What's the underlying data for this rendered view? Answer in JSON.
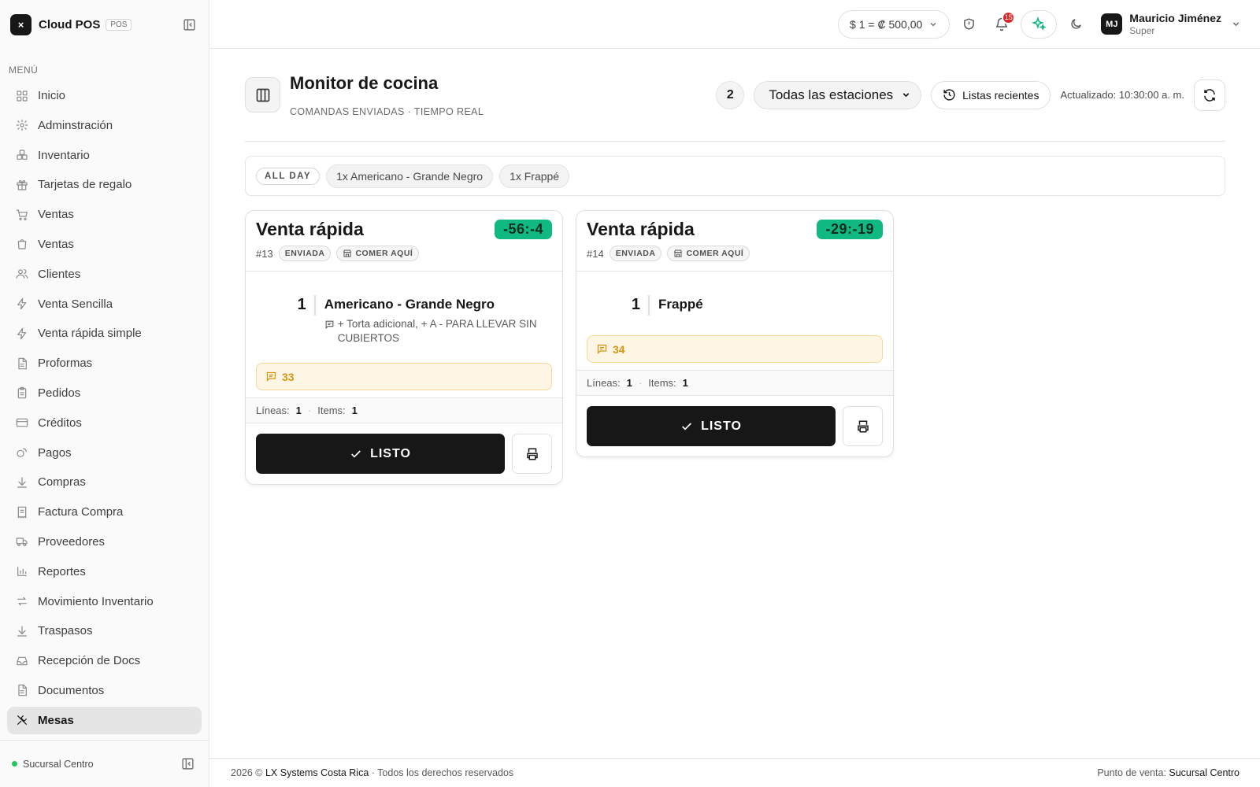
{
  "app": {
    "logo": "×",
    "name": "Cloud POS",
    "badge": "POS"
  },
  "sidebar": {
    "menu_title": "MENÚ",
    "items": [
      {
        "label": "Inicio",
        "icon": "grid-icon"
      },
      {
        "label": "Adminstración",
        "icon": "gear-icon"
      },
      {
        "label": "Inventario",
        "icon": "boxes-icon"
      },
      {
        "label": "Tarjetas de regalo",
        "icon": "gift-icon"
      },
      {
        "label": "Ventas",
        "icon": "cart-icon"
      },
      {
        "label": "Ventas",
        "icon": "shopping-bag-icon"
      },
      {
        "label": "Clientes",
        "icon": "users-icon"
      },
      {
        "label": "Venta Sencilla",
        "icon": "bolt-icon"
      },
      {
        "label": "Venta rápida simple",
        "icon": "bolt-icon"
      },
      {
        "label": "Proformas",
        "icon": "document-icon"
      },
      {
        "label": "Pedidos",
        "icon": "clipboard-icon"
      },
      {
        "label": "Créditos",
        "icon": "credit-card-icon"
      },
      {
        "label": "Pagos",
        "icon": "coins-icon"
      },
      {
        "label": "Compras",
        "icon": "download-icon"
      },
      {
        "label": "Factura Compra",
        "icon": "receipt-icon"
      },
      {
        "label": "Proveedores",
        "icon": "truck-icon"
      },
      {
        "label": "Reportes",
        "icon": "bar-chart-icon"
      },
      {
        "label": "Movimiento Inventario",
        "icon": "arrows-swap-icon"
      },
      {
        "label": "Traspasos",
        "icon": "download-icon"
      },
      {
        "label": "Recepción de Docs",
        "icon": "inbox-icon"
      },
      {
        "label": "Documentos",
        "icon": "document-icon"
      },
      {
        "label": "Mesas",
        "icon": "utensils-icon",
        "active": true
      }
    ],
    "branch": "Sucursal Centro"
  },
  "topbar": {
    "exchange_rate": "$ 1 =  ₡ 500,00",
    "notifications_count": "15",
    "user": {
      "initials": "MJ",
      "name": "Mauricio Jiménez",
      "role": "Super"
    }
  },
  "page": {
    "title": "Monitor de cocina",
    "subtitle": "COMANDAS ENVIADAS · TIEMPO REAL",
    "order_count": "2",
    "station": "Todas las estaciones",
    "recent_button": "Listas recientes",
    "updated": "Actualizado: 10:30:00 a. m."
  },
  "all_day": {
    "tag": "ALL DAY",
    "items": [
      "1x Americano - Grande Negro",
      "1x Frappé"
    ]
  },
  "orders": [
    {
      "title": "Venta rápida",
      "timer": "-56:-4",
      "number": "#13",
      "status": "ENVIADA",
      "service": "COMER AQUÍ",
      "lines": [
        {
          "qty": "1",
          "name": "Americano - Grande Negro",
          "mods": "+ Torta adicional, + A - PARA LLEVAR SIN CUBIERTOS"
        }
      ],
      "note": "33",
      "stats": {
        "lines_label": "Líneas:",
        "lines": "1",
        "items_label": "Items:",
        "items": "1"
      },
      "ready_label": "LISTO"
    },
    {
      "title": "Venta rápida",
      "timer": "-29:-19",
      "number": "#14",
      "status": "ENVIADA",
      "service": "COMER AQUÍ",
      "lines": [
        {
          "qty": "1",
          "name": "Frappé",
          "mods": ""
        }
      ],
      "note": "34",
      "stats": {
        "lines_label": "Líneas:",
        "lines": "1",
        "items_label": "Items:",
        "items": "1"
      },
      "ready_label": "LISTO"
    }
  ],
  "footer": {
    "copyright": "2026 ©",
    "company": "LX Systems Costa Rica",
    "rights": "· Todos los derechos reservados",
    "pos_label": "Punto de venta:",
    "pos_value": "Sucursal Centro"
  },
  "colors": {
    "accent": "#10b981",
    "note_bg": "#fef6e4",
    "note_text": "#d99414",
    "danger": "#dc2626"
  }
}
